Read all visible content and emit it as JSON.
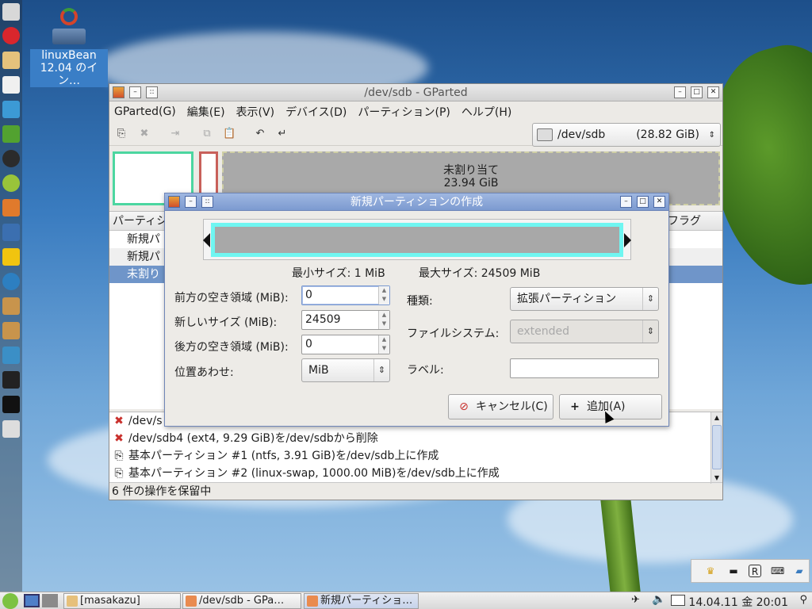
{
  "desktop": {
    "icon_label_line1": "linuxBean",
    "icon_label_line2": "12.04 のイン…"
  },
  "window": {
    "title": "/dev/sdb - GParted",
    "menu": [
      "GParted(G)",
      "編集(E)",
      "表示(V)",
      "デバイス(D)",
      "パーティション(P)",
      "ヘルプ(H)"
    ],
    "device": {
      "name": "/dev/sdb",
      "size": "(28.82 GiB)"
    },
    "diskmap": {
      "unalloc_label": "未割り当て",
      "unalloc_size": "23.94 GiB"
    },
    "list": {
      "col_partition": "パーティシ",
      "col_flags": "フラグ",
      "rows": [
        "新規パ",
        "新規パ",
        "未割り"
      ]
    },
    "oplog": [
      {
        "icon": "delete-icon",
        "text": "/dev/s"
      },
      {
        "icon": "delete-icon",
        "text": "/dev/sdb4 (ext4, 9.29 GiB)を/dev/sdbから削除"
      },
      {
        "icon": "new-partition-icon",
        "text": "基本パーティション #1 (ntfs, 3.91 GiB)を/dev/sdb上に作成"
      },
      {
        "icon": "new-partition-icon",
        "text": "基本パーティション #2 (linux-swap, 1000.00 MiB)を/dev/sdb上に作成"
      }
    ],
    "status": "6 件の操作を保留中"
  },
  "dialog": {
    "title": "新規パーティションの作成",
    "min_size": "最小サイズ: 1 MiB",
    "max_size": "最大サイズ: 24509 MiB",
    "free_before": {
      "label": "前方の空き領域 (MiB):",
      "value": "0"
    },
    "new_size": {
      "label": "新しいサイズ (MiB):",
      "value": "24509"
    },
    "free_after": {
      "label": "後方の空き領域 (MiB):",
      "value": "0"
    },
    "align": {
      "label": "位置あわせ:",
      "value": "MiB"
    },
    "type": {
      "label": "種類:",
      "value": "拡張パーティション"
    },
    "filesystem": {
      "label": "ファイルシステム:",
      "value": "extended"
    },
    "fs_label": {
      "label": "ラベル:",
      "value": ""
    },
    "cancel_label": "キャンセル(C)",
    "add_label": "追加(A)"
  },
  "taskbar": {
    "tasks": [
      "[masakazu]",
      "/dev/sdb - GPa…",
      "新規パーティショ…"
    ],
    "clock": "14.04.11 金 20:01"
  },
  "colors": {
    "accent": "#7c9ad0",
    "selection": "#6f95c9",
    "partition1": "#4cd6a0",
    "partition2": "#c8605a",
    "dialog_bar": "#6ff6f1"
  }
}
